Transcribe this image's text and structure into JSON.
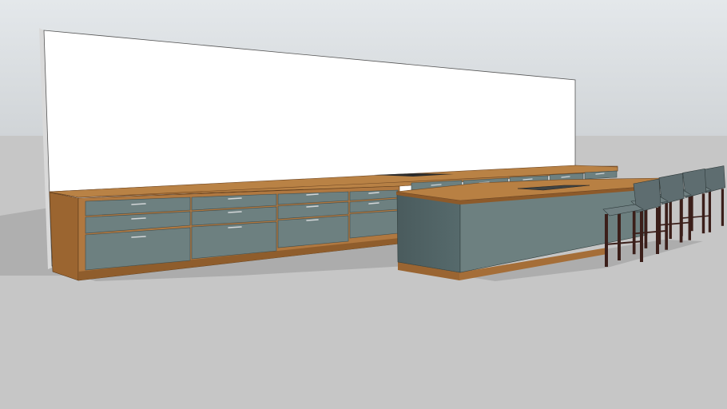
{
  "scene": {
    "description_label": "",
    "colors": {
      "sky_top": "#e3e7ea",
      "sky_bottom": "#d2d6d9",
      "ground": "#c6c6c6",
      "wall": "#ffffff",
      "wall_side": "#d8d8d8",
      "wood": "#b37a3f",
      "wood_dark": "#8a5a2b",
      "cabinet": "#6f8282",
      "cabinet_dark": "#4e5f60",
      "handle": "#c9ced0",
      "shadow": "#9a9a9a",
      "stool_seat": "#5e6d70",
      "stool_leg": "#3b1f1a",
      "cooktop": "#2a2a2a"
    },
    "stool_count": 4
  }
}
